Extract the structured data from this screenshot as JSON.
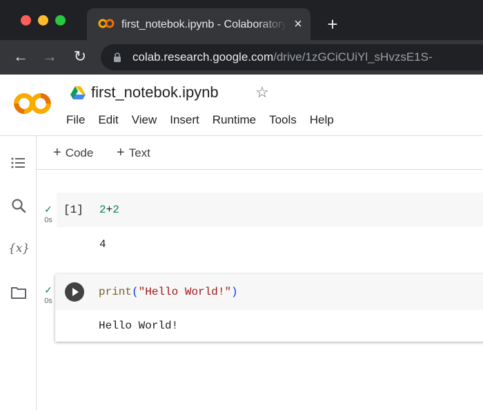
{
  "browser": {
    "tab_title": "first_notebok.ipynb - Colaboratory",
    "tab_close": "×",
    "new_tab": "+",
    "url_host": "colab.research.google.com",
    "url_path": "/drive/1zGCiCUiYl_sHvzsE1S-",
    "back_glyph": "←",
    "forward_glyph": "→",
    "reload_glyph": "↻"
  },
  "notebook": {
    "title": "first_notebok.ipynb",
    "star_glyph": "☆"
  },
  "menu": [
    "File",
    "Edit",
    "View",
    "Insert",
    "Runtime",
    "Tools",
    "Help"
  ],
  "toolbar": {
    "add_code_label": "Code",
    "add_text_label": "Text",
    "plus_glyph": "+"
  },
  "rail": {
    "variables_label": "{x}"
  },
  "cells": [
    {
      "status_glyph": "✓",
      "exec_time": "0s",
      "exec_count": "[1]",
      "code_tokens": [
        "2",
        "+",
        "2"
      ],
      "output": "4"
    },
    {
      "status_glyph": "✓",
      "exec_time": "0s",
      "code_tokens": [
        "print",
        "(",
        "\"Hello World!\"",
        ")"
      ],
      "output": "Hello World!"
    }
  ],
  "colors": {
    "chrome_bg": "#202124",
    "tab_bg": "#35363a",
    "colab_orange": "#f9ab00",
    "colab_dark_orange": "#e8710a",
    "success_green": "#188038",
    "string_red": "#a31515",
    "number_green": "#098658"
  }
}
